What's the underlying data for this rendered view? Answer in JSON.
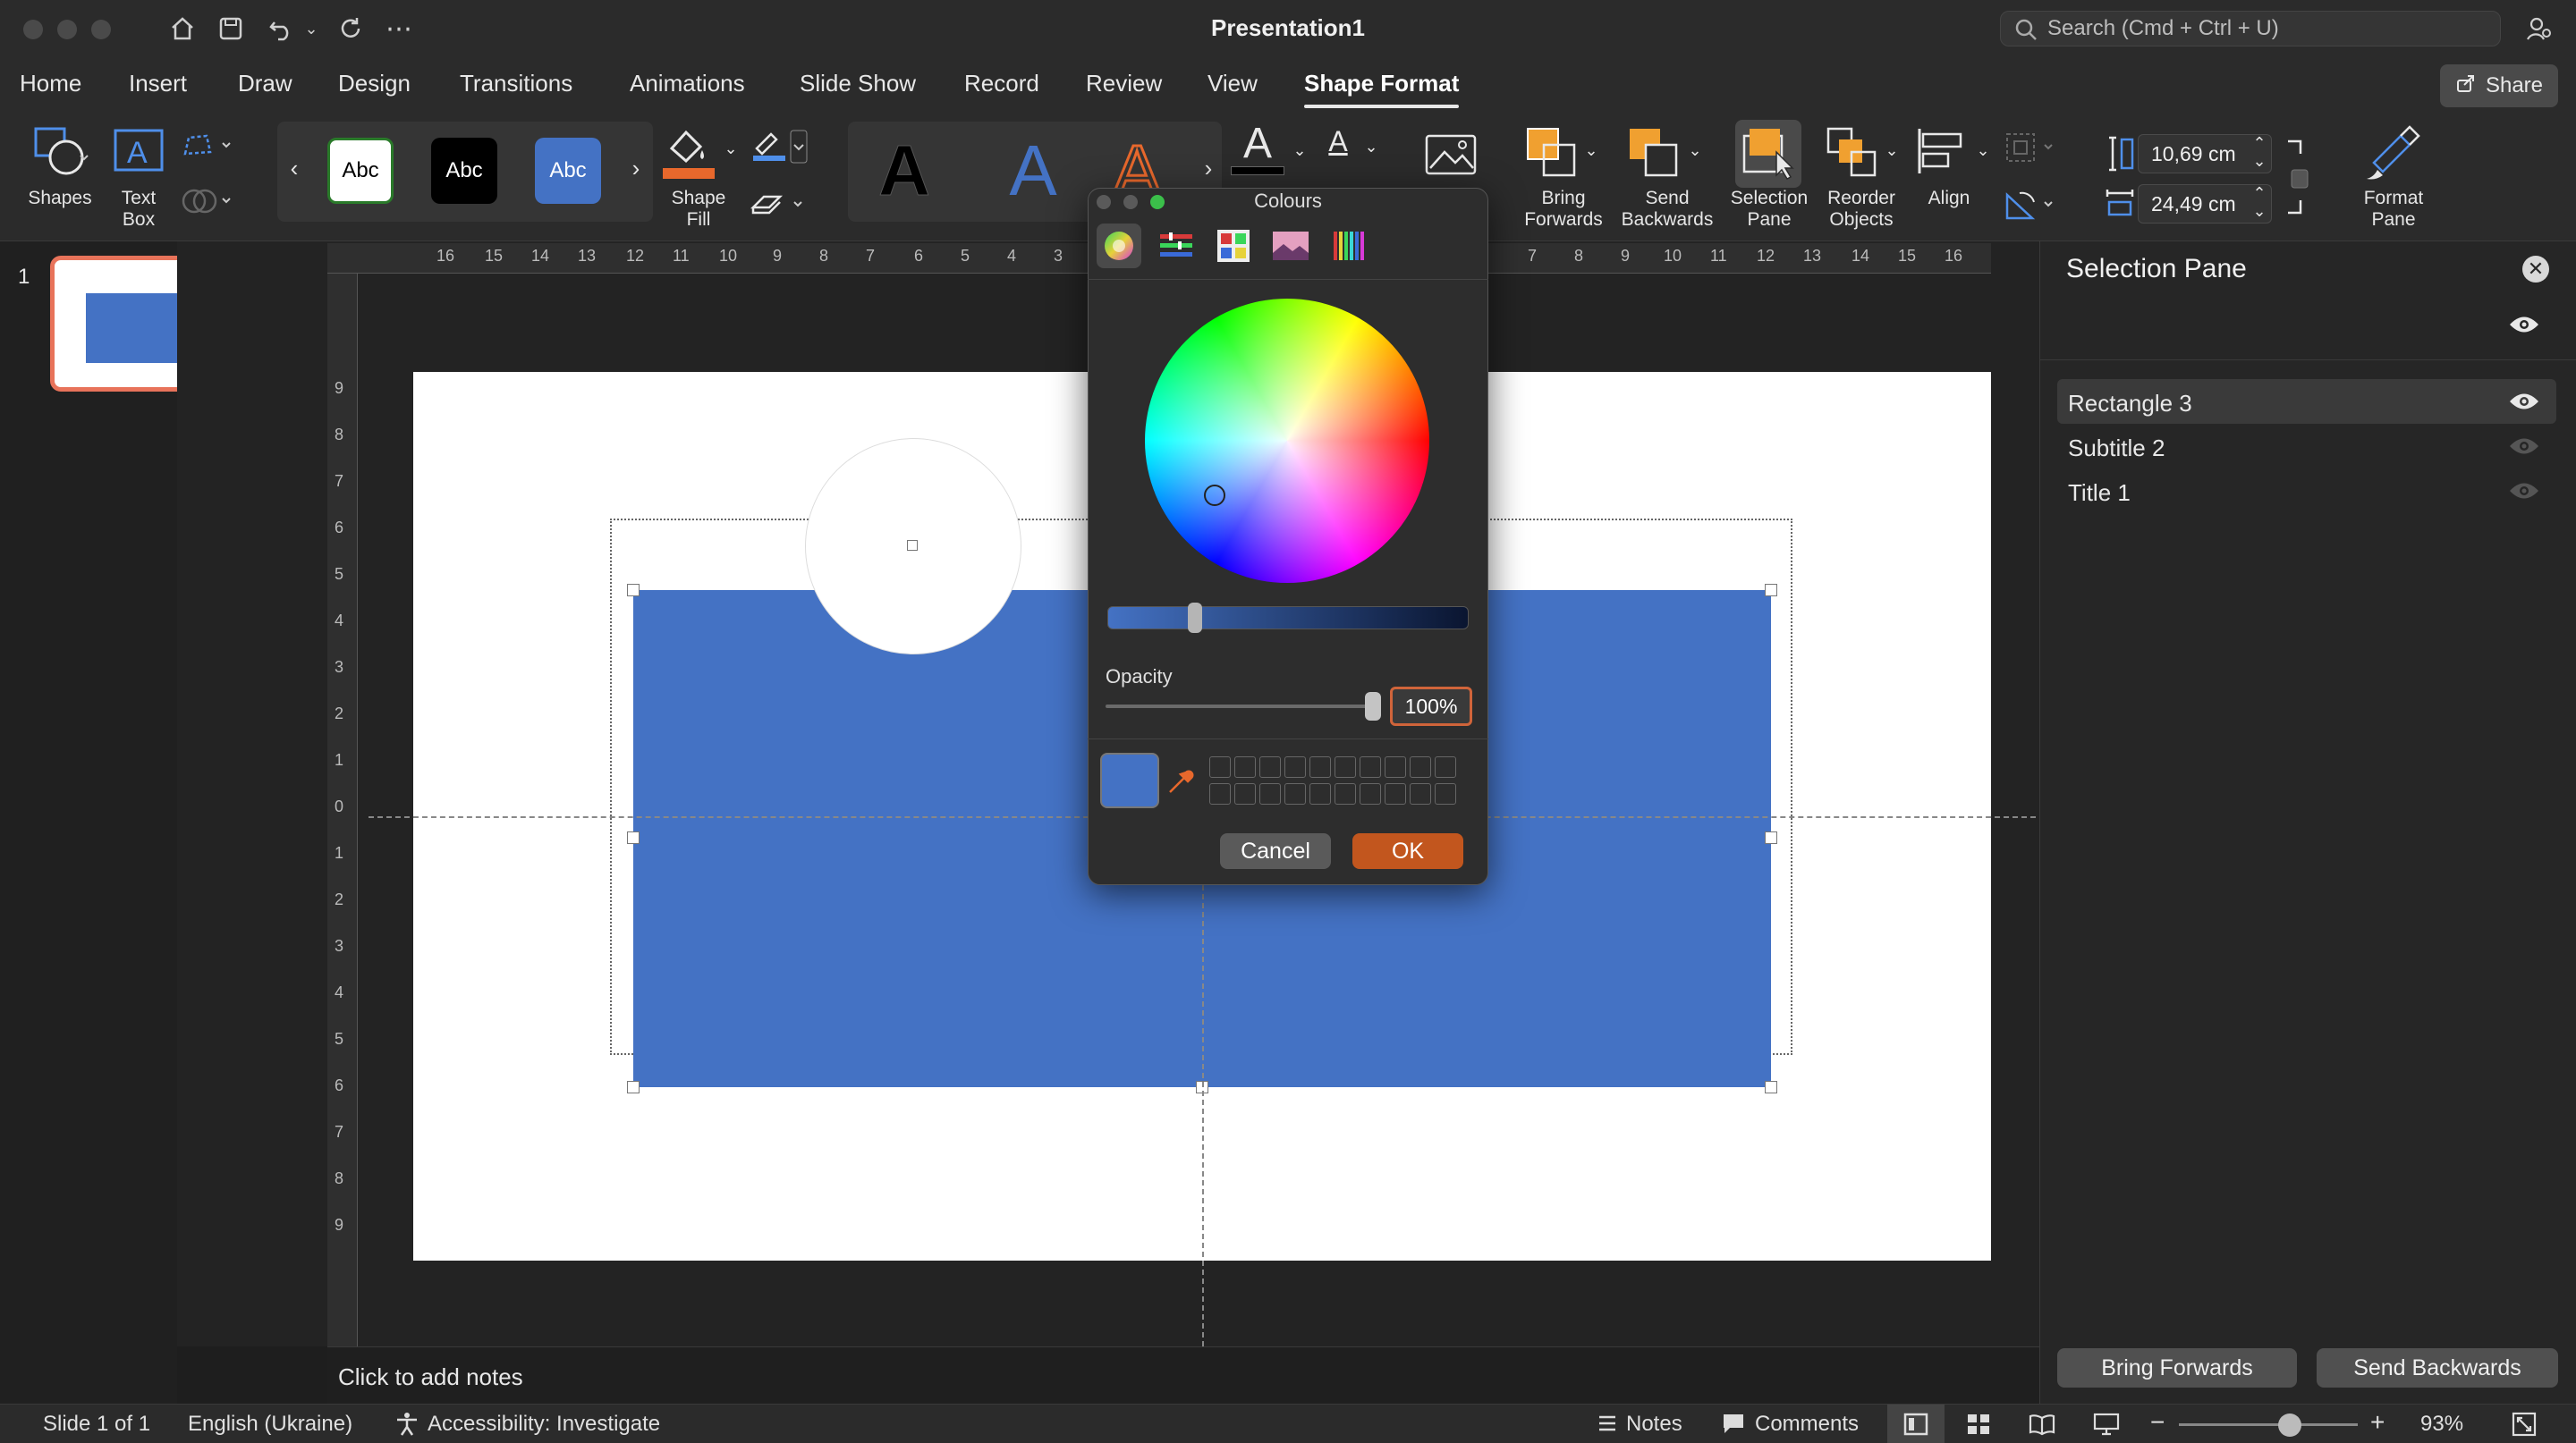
{
  "window": {
    "title": "Presentation1",
    "search_placeholder": "Search (Cmd + Ctrl + U)"
  },
  "menu_tabs": [
    "Home",
    "Insert",
    "Draw",
    "Design",
    "Transitions",
    "Animations",
    "Slide Show",
    "Record",
    "Review",
    "View",
    "Shape Format"
  ],
  "active_tab": "Shape Format",
  "share_label": "Share",
  "ribbon": {
    "shapes": "Shapes",
    "text_box_1": "Text",
    "text_box_2": "Box",
    "style_samples": [
      "Abc",
      "Abc",
      "Abc"
    ],
    "shape_fill_1": "Shape",
    "shape_fill_2": "Fill",
    "wordart_samples": [
      "A",
      "A",
      "A"
    ],
    "text_color_glyph": "A",
    "text_outline_glyph": "A",
    "bring_forwards_1": "Bring",
    "bring_forwards_2": "Forwards",
    "send_backwards_1": "Send",
    "send_backwards_2": "Backwards",
    "selection_pane_1": "Selection",
    "selection_pane_2": "Pane",
    "reorder_objects_1": "Reorder",
    "reorder_objects_2": "Objects",
    "align": "Align",
    "height_value": "10,69 cm",
    "width_value": "24,49 cm",
    "format_pane_1": "Format",
    "format_pane_2": "Pane"
  },
  "thumbnails": {
    "slide_number": "1"
  },
  "ruler": {
    "horizontal": [
      "16",
      "15",
      "14",
      "13",
      "12",
      "11",
      "10",
      "9",
      "8",
      "7",
      "6",
      "5",
      "4",
      "3",
      "7",
      "8",
      "9",
      "10",
      "11",
      "12",
      "13",
      "14",
      "15",
      "16"
    ],
    "vertical": [
      "9",
      "8",
      "7",
      "6",
      "5",
      "4",
      "3",
      "2",
      "1",
      "0",
      "1",
      "2",
      "3",
      "4",
      "5",
      "6",
      "7",
      "8",
      "9"
    ]
  },
  "notes_placeholder": "Click to add notes",
  "selection_pane": {
    "title": "Selection Pane",
    "items": [
      "Rectangle 3",
      "Subtitle 2",
      "Title 1"
    ],
    "bring_forwards": "Bring Forwards",
    "send_backwards": "Send Backwards"
  },
  "status_bar": {
    "slide_info": "Slide 1 of 1",
    "language": "English (Ukraine)",
    "accessibility": "Accessibility: Investigate",
    "notes": "Notes",
    "comments": "Comments",
    "zoom": "93%",
    "zoom_fraction": 0.62
  },
  "colours_dialog": {
    "title": "Colours",
    "opacity_label": "Opacity",
    "opacity_value": "100%",
    "opacity_fraction": 1.0,
    "current_color": "#4472c4",
    "cancel": "Cancel",
    "ok": "OK",
    "modes": [
      "colour-wheel-icon",
      "colour-sliders-icon",
      "colour-palettes-icon",
      "image-palettes-icon",
      "pencils-icon"
    ]
  },
  "colors": {
    "accent_blue": "#4472c4",
    "accent_orange": "#d0643a",
    "thumb_border": "#e8735a"
  }
}
